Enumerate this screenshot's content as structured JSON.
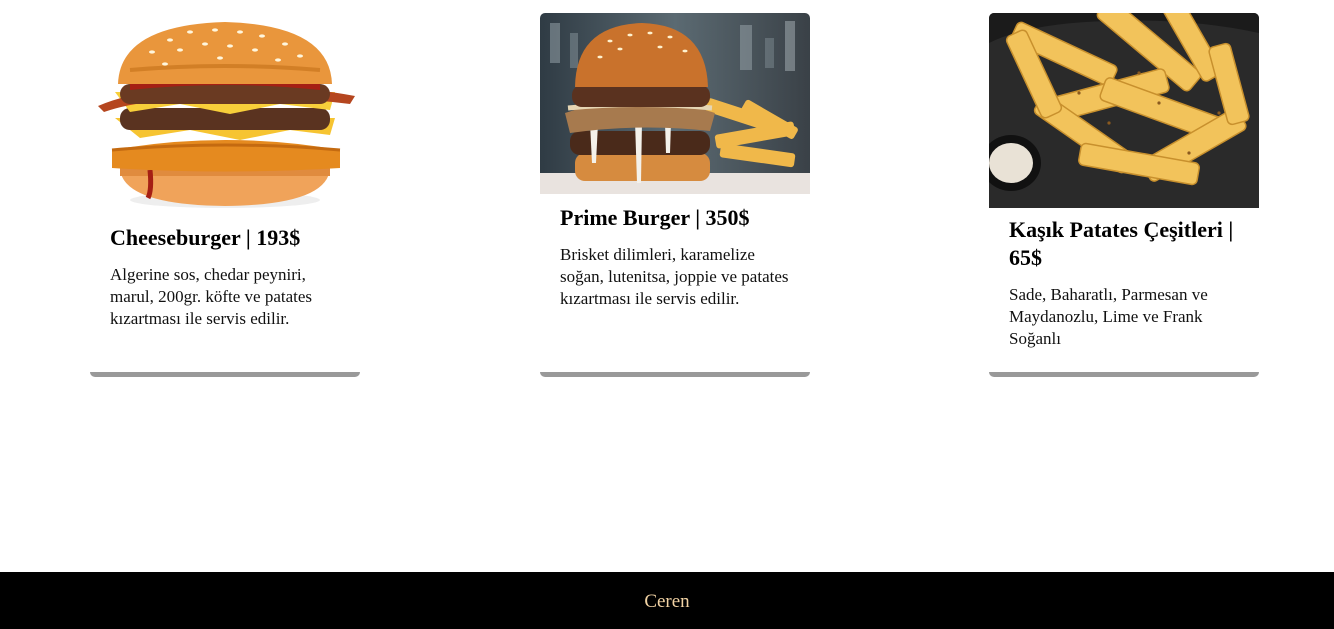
{
  "menu": {
    "items": [
      {
        "title": "Cheeseburger | 193$",
        "description": "Algerine sos, chedar peyniri, marul, 200gr. köfte ve patates kızartması ile servis edilir.",
        "image": "cheeseburger-photo"
      },
      {
        "title": "Prime Burger | 350$",
        "description": "Brisket dilimleri, karamelize soğan, lutenitsa, joppie ve patates kızartması ile servis edilir.",
        "image": "prime-burger-photo"
      },
      {
        "title": "Kaşık Patates Çeşitleri | 65$",
        "description": "Sade, Baharatlı, Parmesan ve Maydanozlu, Lime ve Frank Soğanlı",
        "image": "fries-photo"
      }
    ]
  },
  "footer": {
    "text": "Ceren",
    "text_color": "#f2d3a4",
    "background": "#000000"
  },
  "colors": {
    "card_shadow": "#999999"
  }
}
